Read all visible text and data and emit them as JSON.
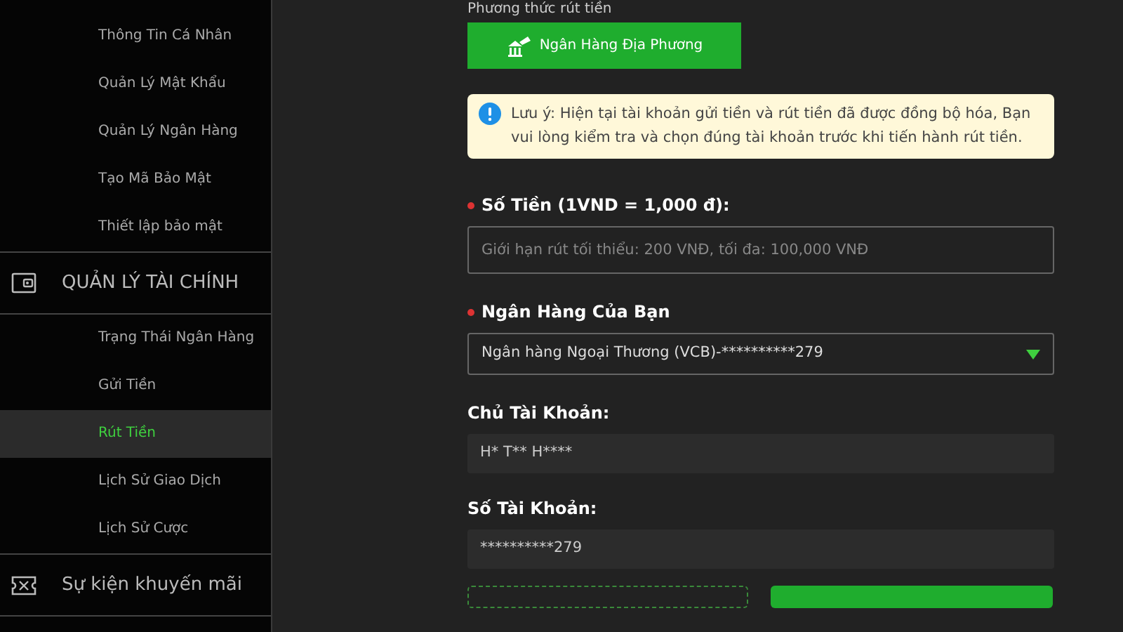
{
  "menu": [
    {
      "children": [
        {
          "label": "Thông Tin Cá Nhân",
          "selected": false
        },
        {
          "label": "Quản Lý Mật Khẩu",
          "selected": false
        },
        {
          "label": "Quản Lý Ngân Hàng",
          "selected": false
        },
        {
          "label": "Tạo Mã Bảo Mật",
          "selected": false
        },
        {
          "label": "Thiết lập bảo mật",
          "selected": false
        }
      ]
    },
    {
      "label": "QUẢN LÝ TÀI CHÍNH",
      "children": [
        {
          "label": "Trạng Thái Ngân Hàng",
          "selected": false
        },
        {
          "label": "Gửi Tiền",
          "selected": false
        },
        {
          "label": "Rút Tiền",
          "selected": true
        },
        {
          "label": "Lịch Sử Giao Dịch",
          "selected": false
        },
        {
          "label": "Lịch Sử Cược",
          "selected": false
        }
      ]
    },
    {
      "label": "Sự kiện khuyến mãi"
    }
  ],
  "withdraw_method": {
    "label": "Phương thức rút tiền",
    "options": [
      {
        "label": "Ngân Hàng Địa Phương",
        "selected": true
      }
    ]
  },
  "notice": "Lưu ý: Hiện tại tài khoản gửi tiền và rút tiền đã được đồng bộ hóa, Bạn vui lòng kiểm tra và chọn đúng tài khoản trước khi tiến hành rút tiền.",
  "fields": [
    {
      "kind": "input",
      "label": "Số Tiền (1VND = 1,000 đ):",
      "required": true,
      "placeholder": "Giới hạn rút tối thiểu: 200 VNĐ, tối đa: 100,000 VNĐ"
    },
    {
      "kind": "select",
      "label": "Ngân Hàng Của Bạn",
      "required": true,
      "value": "Ngân hàng Ngoại Thương (VCB)-**********279"
    },
    {
      "kind": "readonly",
      "label": "Chủ Tài Khoản:",
      "required": false,
      "value": "H* T** H****"
    },
    {
      "kind": "readonly",
      "label": "Số Tài Khoản:",
      "required": false,
      "value": "**********279"
    }
  ],
  "buttons": [
    {
      "kind": "outline"
    },
    {
      "kind": "primary"
    }
  ]
}
